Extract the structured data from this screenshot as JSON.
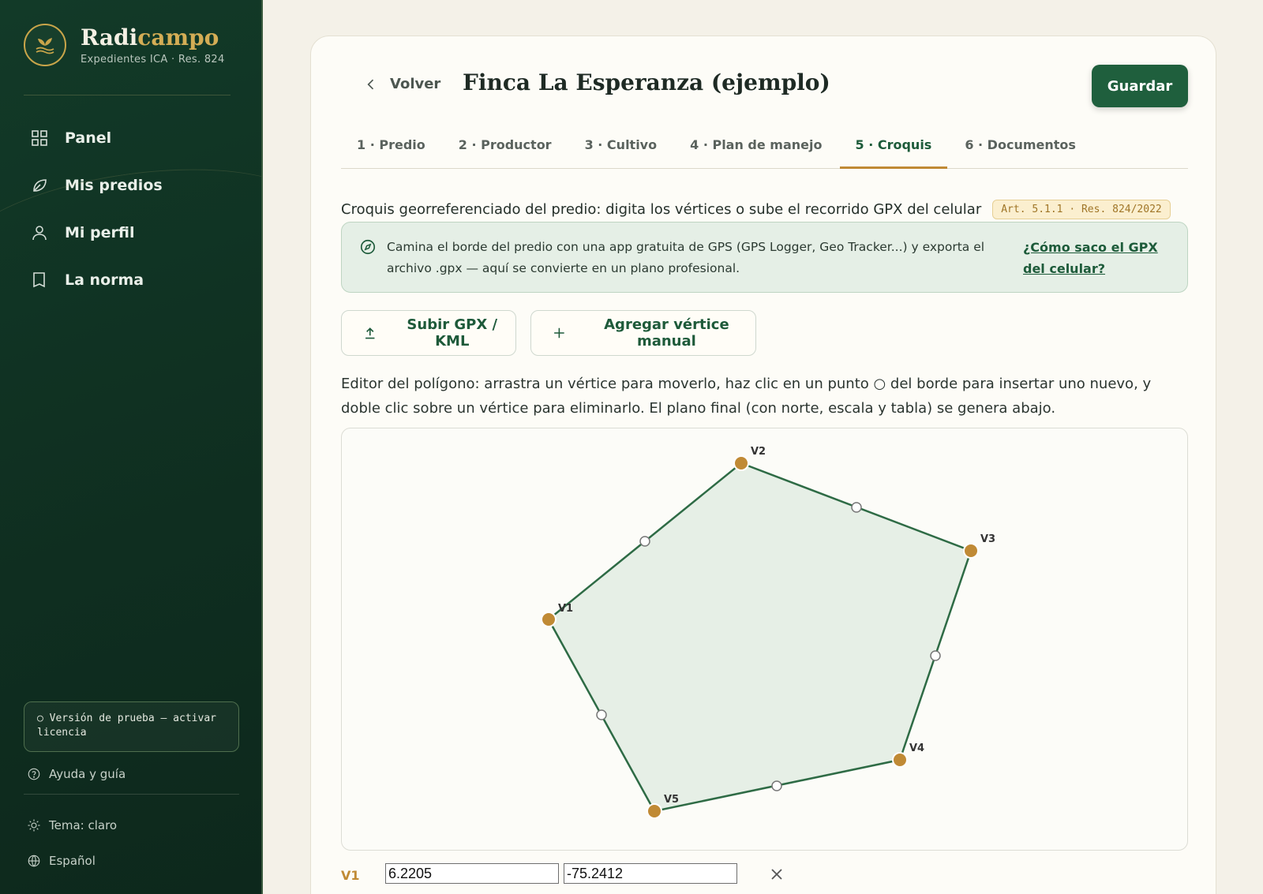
{
  "sidebar": {
    "brand": {
      "name_part1": "Radi",
      "name_part2": "campo",
      "subtitle": "Expedientes ICA · Res. 824"
    },
    "nav": [
      {
        "label": "Panel",
        "icon": "grid-icon"
      },
      {
        "label": "Mis predios",
        "icon": "leaf-icon"
      },
      {
        "label": "Mi perfil",
        "icon": "user-icon"
      },
      {
        "label": "La norma",
        "icon": "book-icon"
      }
    ],
    "trial": "○ Versión de prueba — activar licencia",
    "help": "Ayuda y guía",
    "theme": "Tema: claro",
    "language": "Español"
  },
  "header": {
    "back_label": "Volver",
    "title": "Finca La Esperanza (ejemplo)",
    "save_label": "Guardar"
  },
  "tabs": [
    {
      "label": "1 · Predio",
      "active": false
    },
    {
      "label": "2 · Productor",
      "active": false
    },
    {
      "label": "3 · Cultivo",
      "active": false
    },
    {
      "label": "4 · Plan de manejo",
      "active": false
    },
    {
      "label": "5 · Croquis",
      "active": true
    },
    {
      "label": "6 · Documentos",
      "active": false
    }
  ],
  "croquis": {
    "intro": "Croquis georreferenciado del predio: digita los vértices o sube el recorrido GPX del celular",
    "ref_badge": "Art. 5.1.1 · Res. 824/2022",
    "info_text": "Camina el borde del predio con una app gratuita de GPS (GPS Logger, Geo Tracker...) y exporta el archivo .gpx — aquí se convierte en un plano profesional.",
    "info_link": "¿Cómo saco el GPX del celular?",
    "upload_label": "Subir GPX / KML",
    "add_vertex_label": "Agregar vértice manual",
    "editor_desc": "Editor del polígono: arrastra un vértice para moverlo, haz clic en un punto ○ del borde para insertar uno nuevo, y doble clic sobre un vértice para eliminarlo. El plano final (con norte, escala y tabla) se genera abajo.",
    "vertex_labels": [
      "V1",
      "V2",
      "V3",
      "V4",
      "V5"
    ]
  },
  "vertex_rows": [
    {
      "label": "V1",
      "lat": "6.2205",
      "lon": "-75.2412"
    }
  ],
  "colors": {
    "primary": "#1f5f3d",
    "accent": "#c08a35",
    "polygon_fill": "#e6efe6",
    "sidebar": "#123a28"
  }
}
